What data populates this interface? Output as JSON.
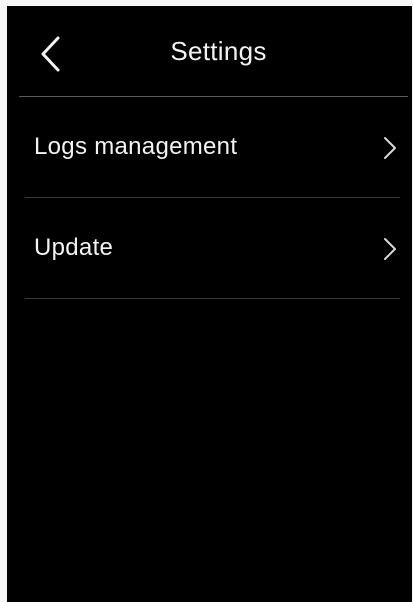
{
  "header": {
    "title": "Settings",
    "back_icon": "chevron-left-icon"
  },
  "menu": {
    "items": [
      {
        "label": "Logs management",
        "icon": "chevron-right-icon"
      },
      {
        "label": "Update",
        "icon": "chevron-right-icon"
      }
    ]
  },
  "colors": {
    "screen_background": "#000000",
    "text": "#f2f2f2",
    "divider": "#3a3a3a",
    "frame_background": "#f6f6f6"
  }
}
